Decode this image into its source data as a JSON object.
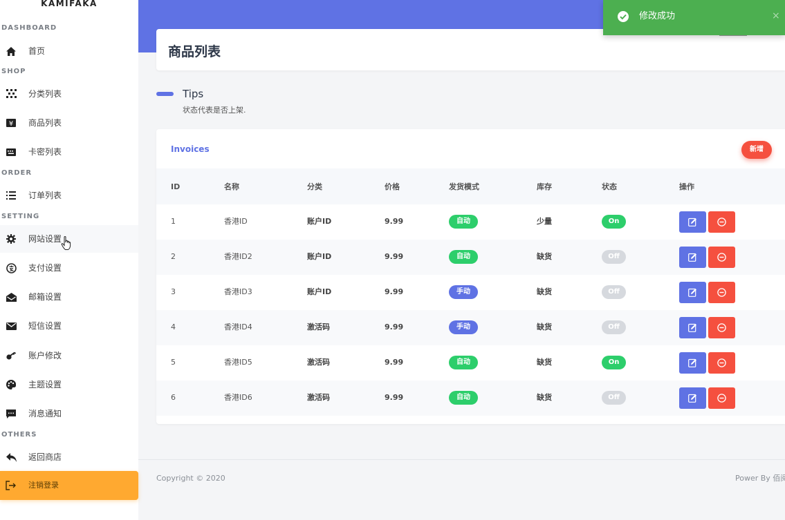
{
  "sidebar": {
    "brand": "KAMIFAKA",
    "sections": {
      "dashboard": "DASHBOARD",
      "shop": "SHOP",
      "order": "ORDER",
      "setting": "SETTING",
      "others": "OTHERS"
    },
    "items": [
      {
        "label": "首页",
        "icon": "home-icon"
      },
      {
        "label": "分类列表",
        "icon": "category-icon"
      },
      {
        "label": "商品列表",
        "icon": "product-icon"
      },
      {
        "label": "卡密列表",
        "icon": "card-key-icon"
      },
      {
        "label": "订单列表",
        "icon": "order-list-icon"
      },
      {
        "label": "网站设置",
        "icon": "gear-icon"
      },
      {
        "label": "支付设置",
        "icon": "payment-icon"
      },
      {
        "label": "邮箱设置",
        "icon": "mailbox-icon"
      },
      {
        "label": "短信设置",
        "icon": "sms-envelope-icon"
      },
      {
        "label": "账户修改",
        "icon": "key-icon"
      },
      {
        "label": "主题设置",
        "icon": "palette-icon"
      },
      {
        "label": "消息通知",
        "icon": "message-icon"
      },
      {
        "label": "返回商店",
        "icon": "reply-icon"
      }
    ],
    "logout": {
      "label": "注销登录",
      "icon": "logout-icon"
    }
  },
  "page": {
    "title": "商品列表"
  },
  "tips": {
    "title": "Tips",
    "text": "状态代表是否上架."
  },
  "card": {
    "title": "Invoices",
    "add_label": "新增"
  },
  "table": {
    "columns": [
      "ID",
      "名称",
      "分类",
      "价格",
      "发货模式",
      "库存",
      "状态",
      "操作"
    ],
    "rows": [
      {
        "id": "1",
        "name": "香港ID",
        "category": "账户ID",
        "price": "9.99",
        "mode": "自动",
        "mode_type": "auto",
        "stock": "少量",
        "status": "On"
      },
      {
        "id": "2",
        "name": "香港ID2",
        "category": "账户ID",
        "price": "9.99",
        "mode": "自动",
        "mode_type": "auto",
        "stock": "缺货",
        "status": "Off"
      },
      {
        "id": "3",
        "name": "香港ID3",
        "category": "账户ID",
        "price": "9.99",
        "mode": "手动",
        "mode_type": "manual",
        "stock": "缺货",
        "status": "Off"
      },
      {
        "id": "4",
        "name": "香港ID4",
        "category": "激活码",
        "price": "9.99",
        "mode": "手动",
        "mode_type": "manual",
        "stock": "缺货",
        "status": "Off"
      },
      {
        "id": "5",
        "name": "香港ID5",
        "category": "激活码",
        "price": "9.99",
        "mode": "自动",
        "mode_type": "auto",
        "stock": "缺货",
        "status": "On"
      },
      {
        "id": "6",
        "name": "香港ID6",
        "category": "激活码",
        "price": "9.99",
        "mode": "自动",
        "mode_type": "auto",
        "stock": "缺货",
        "status": "Off"
      }
    ]
  },
  "footer": {
    "copyright": "Copyright © 2020",
    "powered": "Power By 佰阅"
  },
  "toast": {
    "message": "修改成功",
    "close": "×"
  },
  "colors": {
    "primary": "#5f72e4",
    "success": "#2dce6b",
    "danger": "#f5503f",
    "warning": "#ffa930",
    "toast": "#4caf50"
  }
}
